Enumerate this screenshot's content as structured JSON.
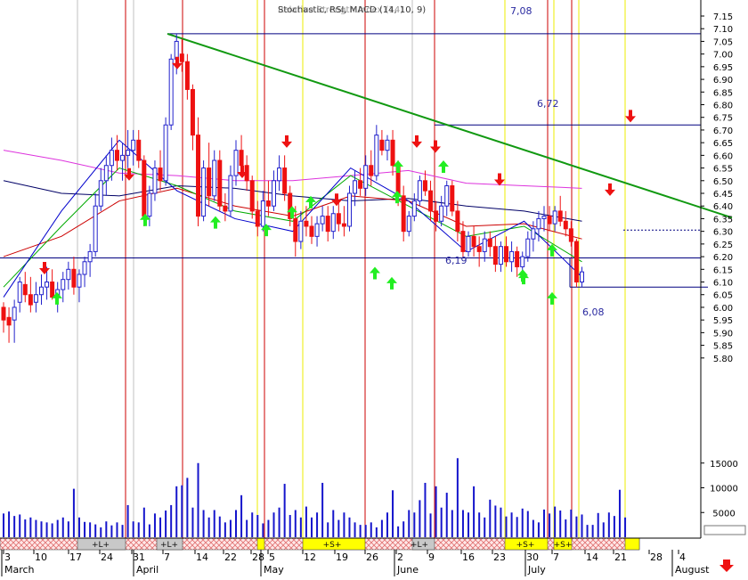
{
  "header": {
    "overlay_text": "Stochastic, RSI, MACD (14, 10, 9)",
    "overlay_text2": "Relative Strength Index (14)"
  },
  "colors": {
    "up_candle": "#2222cc",
    "down_candle": "#ee1111",
    "trendline": "#119911",
    "ma_magenta": "#dd33dd",
    "ma_navy": "#000066",
    "ma_red": "#cc0000",
    "ma_green": "#00aa00",
    "ma_blue": "#0000cc",
    "buy_arrow": "#22ee22",
    "sell_arrow": "#ee1111",
    "red_vline": "#cc0000",
    "yellow_vline": "#eeee00",
    "signal_yellow": "#ffff00",
    "signal_gray": "#c8c8c8",
    "signal_hatch": "#ffb4b4",
    "level_line": "#000080"
  },
  "chart_data": {
    "type": "candlestick",
    "price_axis": {
      "ylim": [
        5.78,
        7.18
      ],
      "tick_labels": [
        "7.15",
        "7.10",
        "7.05",
        "7.00",
        "6.95",
        "6.90",
        "6.85",
        "6.80",
        "6.75",
        "6.70",
        "6.65",
        "6.60",
        "6.55",
        "6.50",
        "6.45",
        "6.40",
        "6.35",
        "6.30",
        "6.25",
        "6.20",
        "6.15",
        "6.10",
        "6.05",
        "6.00",
        "5.95",
        "5.90",
        "5.85",
        "5.80"
      ]
    },
    "volume_axis": {
      "ylim": [
        0,
        17000
      ],
      "tick_labels": [
        "15000",
        "10000",
        "5000"
      ]
    },
    "level_annotations": [
      {
        "label": "7,08",
        "value": 7.08
      },
      {
        "label": "6,72",
        "value": 6.72
      },
      {
        "label": "6,19",
        "value": 6.195
      },
      {
        "label": "6,08",
        "value": 6.08
      }
    ],
    "dotted_level": 6.305,
    "trendline": {
      "from": {
        "x": "Apr 7",
        "y": 7.08
      },
      "to": {
        "x": "Aug 4",
        "y": 6.34
      }
    },
    "x_axis": {
      "day_labels": [
        "3",
        "10",
        "17",
        "24",
        "31",
        "7",
        "14",
        "22",
        "28",
        "5",
        "12",
        "19",
        "26",
        "2",
        "9",
        "16",
        "23",
        "30",
        "7",
        "14",
        "21",
        "28",
        "4"
      ],
      "month_labels": [
        "March",
        "April",
        "May",
        "June",
        "July",
        "August"
      ]
    },
    "signal_bar": {
      "labels": [
        "+L+",
        "+L+",
        "+S+",
        "+L+",
        "+S+",
        "+S+"
      ]
    },
    "candles": [
      {
        "o": 6.0,
        "h": 6.02,
        "l": 5.9,
        "c": 5.95
      },
      {
        "o": 5.96,
        "h": 6.0,
        "l": 5.86,
        "c": 5.93
      },
      {
        "o": 5.95,
        "h": 6.03,
        "l": 5.86,
        "c": 6.0
      },
      {
        "o": 6.02,
        "h": 6.12,
        "l": 5.98,
        "c": 6.1
      },
      {
        "o": 6.09,
        "h": 6.14,
        "l": 6.02,
        "c": 6.05
      },
      {
        "o": 6.05,
        "h": 6.12,
        "l": 5.98,
        "c": 6.01
      },
      {
        "o": 6.02,
        "h": 6.1,
        "l": 5.98,
        "c": 6.05
      },
      {
        "o": 6.05,
        "h": 6.13,
        "l": 6.01,
        "c": 6.08
      },
      {
        "o": 6.08,
        "h": 6.16,
        "l": 6.03,
        "c": 6.1
      },
      {
        "o": 6.1,
        "h": 6.15,
        "l": 6.03,
        "c": 6.04
      },
      {
        "o": 6.04,
        "h": 6.1,
        "l": 5.98,
        "c": 6.07
      },
      {
        "o": 6.07,
        "h": 6.14,
        "l": 6.02,
        "c": 6.11
      },
      {
        "o": 6.11,
        "h": 6.18,
        "l": 6.07,
        "c": 6.15
      },
      {
        "o": 6.15,
        "h": 6.2,
        "l": 6.05,
        "c": 6.08
      },
      {
        "o": 6.08,
        "h": 6.15,
        "l": 6.02,
        "c": 6.13
      },
      {
        "o": 6.13,
        "h": 6.2,
        "l": 6.08,
        "c": 6.18
      },
      {
        "o": 6.18,
        "h": 6.25,
        "l": 6.12,
        "c": 6.22
      },
      {
        "o": 6.22,
        "h": 6.45,
        "l": 6.2,
        "c": 6.4
      },
      {
        "o": 6.4,
        "h": 6.55,
        "l": 6.38,
        "c": 6.5
      },
      {
        "o": 6.5,
        "h": 6.6,
        "l": 6.44,
        "c": 6.56
      },
      {
        "o": 6.56,
        "h": 6.67,
        "l": 6.5,
        "c": 6.62
      },
      {
        "o": 6.62,
        "h": 6.68,
        "l": 6.54,
        "c": 6.58
      },
      {
        "o": 6.58,
        "h": 6.65,
        "l": 6.5,
        "c": 6.6
      },
      {
        "o": 6.6,
        "h": 6.7,
        "l": 6.55,
        "c": 6.62
      },
      {
        "o": 6.62,
        "h": 6.7,
        "l": 6.56,
        "c": 6.66
      },
      {
        "o": 6.66,
        "h": 6.7,
        "l": 6.55,
        "c": 6.58
      },
      {
        "o": 6.58,
        "h": 6.6,
        "l": 6.32,
        "c": 6.36
      },
      {
        "o": 6.36,
        "h": 6.48,
        "l": 6.32,
        "c": 6.45
      },
      {
        "o": 6.45,
        "h": 6.58,
        "l": 6.42,
        "c": 6.55
      },
      {
        "o": 6.55,
        "h": 6.62,
        "l": 6.46,
        "c": 6.5
      },
      {
        "o": 6.5,
        "h": 6.75,
        "l": 6.48,
        "c": 6.72
      },
      {
        "o": 6.72,
        "h": 7.0,
        "l": 6.7,
        "c": 6.98
      },
      {
        "o": 6.98,
        "h": 7.08,
        "l": 6.92,
        "c": 7.05
      },
      {
        "o": 7.0,
        "h": 7.06,
        "l": 6.93,
        "c": 6.97
      },
      {
        "o": 6.97,
        "h": 7.0,
        "l": 6.82,
        "c": 6.86
      },
      {
        "o": 6.86,
        "h": 6.88,
        "l": 6.62,
        "c": 6.68
      },
      {
        "o": 6.68,
        "h": 6.75,
        "l": 6.32,
        "c": 6.36
      },
      {
        "o": 6.36,
        "h": 6.58,
        "l": 6.34,
        "c": 6.55
      },
      {
        "o": 6.55,
        "h": 6.65,
        "l": 6.4,
        "c": 6.44
      },
      {
        "o": 6.44,
        "h": 6.62,
        "l": 6.42,
        "c": 6.58
      },
      {
        "o": 6.58,
        "h": 6.62,
        "l": 6.38,
        "c": 6.4
      },
      {
        "o": 6.4,
        "h": 6.45,
        "l": 6.34,
        "c": 6.38
      },
      {
        "o": 6.38,
        "h": 6.56,
        "l": 6.36,
        "c": 6.52
      },
      {
        "o": 6.52,
        "h": 6.66,
        "l": 6.48,
        "c": 6.62
      },
      {
        "o": 6.62,
        "h": 6.68,
        "l": 6.52,
        "c": 6.56
      },
      {
        "o": 6.56,
        "h": 6.6,
        "l": 6.46,
        "c": 6.5
      },
      {
        "o": 6.5,
        "h": 6.52,
        "l": 6.35,
        "c": 6.38
      },
      {
        "o": 6.38,
        "h": 6.42,
        "l": 6.28,
        "c": 6.32
      },
      {
        "o": 6.32,
        "h": 6.46,
        "l": 6.3,
        "c": 6.42
      },
      {
        "o": 6.42,
        "h": 6.5,
        "l": 6.36,
        "c": 6.4
      },
      {
        "o": 6.4,
        "h": 6.54,
        "l": 6.38,
        "c": 6.5
      },
      {
        "o": 6.5,
        "h": 6.6,
        "l": 6.46,
        "c": 6.55
      },
      {
        "o": 6.55,
        "h": 6.6,
        "l": 6.42,
        "c": 6.45
      },
      {
        "o": 6.45,
        "h": 6.48,
        "l": 6.32,
        "c": 6.35
      },
      {
        "o": 6.35,
        "h": 6.4,
        "l": 6.2,
        "c": 6.26
      },
      {
        "o": 6.26,
        "h": 6.38,
        "l": 6.23,
        "c": 6.34
      },
      {
        "o": 6.34,
        "h": 6.4,
        "l": 6.28,
        "c": 6.32
      },
      {
        "o": 6.32,
        "h": 6.36,
        "l": 6.25,
        "c": 6.28
      },
      {
        "o": 6.28,
        "h": 6.36,
        "l": 6.24,
        "c": 6.33
      },
      {
        "o": 6.33,
        "h": 6.4,
        "l": 6.3,
        "c": 6.36
      },
      {
        "o": 6.36,
        "h": 6.4,
        "l": 6.26,
        "c": 6.3
      },
      {
        "o": 6.3,
        "h": 6.4,
        "l": 6.27,
        "c": 6.37
      },
      {
        "o": 6.37,
        "h": 6.42,
        "l": 6.3,
        "c": 6.33
      },
      {
        "o": 6.33,
        "h": 6.4,
        "l": 6.28,
        "c": 6.32
      },
      {
        "o": 6.32,
        "h": 6.48,
        "l": 6.3,
        "c": 6.45
      },
      {
        "o": 6.45,
        "h": 6.54,
        "l": 6.4,
        "c": 6.5
      },
      {
        "o": 6.5,
        "h": 6.55,
        "l": 6.44,
        "c": 6.47
      },
      {
        "o": 6.47,
        "h": 6.6,
        "l": 6.44,
        "c": 6.56
      },
      {
        "o": 6.56,
        "h": 6.62,
        "l": 6.48,
        "c": 6.52
      },
      {
        "o": 6.52,
        "h": 6.72,
        "l": 6.5,
        "c": 6.68
      },
      {
        "o": 6.66,
        "h": 6.7,
        "l": 6.6,
        "c": 6.62
      },
      {
        "o": 6.62,
        "h": 6.68,
        "l": 6.58,
        "c": 6.66
      },
      {
        "o": 6.66,
        "h": 6.7,
        "l": 6.52,
        "c": 6.56
      },
      {
        "o": 6.56,
        "h": 6.58,
        "l": 6.4,
        "c": 6.44
      },
      {
        "o": 6.44,
        "h": 6.48,
        "l": 6.26,
        "c": 6.3
      },
      {
        "o": 6.3,
        "h": 6.38,
        "l": 6.28,
        "c": 6.36
      },
      {
        "o": 6.36,
        "h": 6.45,
        "l": 6.34,
        "c": 6.42
      },
      {
        "o": 6.42,
        "h": 6.52,
        "l": 6.4,
        "c": 6.5
      },
      {
        "o": 6.5,
        "h": 6.54,
        "l": 6.44,
        "c": 6.46
      },
      {
        "o": 6.46,
        "h": 6.5,
        "l": 6.34,
        "c": 6.38
      },
      {
        "o": 6.38,
        "h": 6.42,
        "l": 6.3,
        "c": 6.34
      },
      {
        "o": 6.34,
        "h": 6.44,
        "l": 6.32,
        "c": 6.4
      },
      {
        "o": 6.4,
        "h": 6.5,
        "l": 6.36,
        "c": 6.48
      },
      {
        "o": 6.48,
        "h": 6.5,
        "l": 6.36,
        "c": 6.38
      },
      {
        "o": 6.38,
        "h": 6.42,
        "l": 6.26,
        "c": 6.3
      },
      {
        "o": 6.3,
        "h": 6.34,
        "l": 6.2,
        "c": 6.22
      },
      {
        "o": 6.22,
        "h": 6.3,
        "l": 6.2,
        "c": 6.28
      },
      {
        "o": 6.28,
        "h": 6.32,
        "l": 6.2,
        "c": 6.24
      },
      {
        "o": 6.24,
        "h": 6.28,
        "l": 6.16,
        "c": 6.22
      },
      {
        "o": 6.22,
        "h": 6.3,
        "l": 6.18,
        "c": 6.27
      },
      {
        "o": 6.27,
        "h": 6.3,
        "l": 6.2,
        "c": 6.24
      },
      {
        "o": 6.24,
        "h": 6.28,
        "l": 6.14,
        "c": 6.17
      },
      {
        "o": 6.17,
        "h": 6.26,
        "l": 6.14,
        "c": 6.24
      },
      {
        "o": 6.24,
        "h": 6.28,
        "l": 6.16,
        "c": 6.18
      },
      {
        "o": 6.18,
        "h": 6.26,
        "l": 6.14,
        "c": 6.22
      },
      {
        "o": 6.22,
        "h": 6.24,
        "l": 6.12,
        "c": 6.16
      },
      {
        "o": 6.16,
        "h": 6.22,
        "l": 6.12,
        "c": 6.2
      },
      {
        "o": 6.2,
        "h": 6.3,
        "l": 6.18,
        "c": 6.27
      },
      {
        "o": 6.27,
        "h": 6.34,
        "l": 6.22,
        "c": 6.31
      },
      {
        "o": 6.31,
        "h": 6.38,
        "l": 6.26,
        "c": 6.35
      },
      {
        "o": 6.35,
        "h": 6.4,
        "l": 6.3,
        "c": 6.36
      },
      {
        "o": 6.36,
        "h": 6.4,
        "l": 6.3,
        "c": 6.33
      },
      {
        "o": 6.33,
        "h": 6.4,
        "l": 6.3,
        "c": 6.38
      },
      {
        "o": 6.38,
        "h": 6.44,
        "l": 6.32,
        "c": 6.34
      },
      {
        "o": 6.34,
        "h": 6.38,
        "l": 6.28,
        "c": 6.31
      },
      {
        "o": 6.31,
        "h": 6.34,
        "l": 6.24,
        "c": 6.26
      },
      {
        "o": 6.26,
        "h": 6.27,
        "l": 6.08,
        "c": 6.1
      },
      {
        "o": 6.1,
        "h": 6.16,
        "l": 6.08,
        "c": 6.14
      }
    ],
    "volume": [
      4800,
      5200,
      4300,
      4600,
      3600,
      4000,
      3500,
      3200,
      3000,
      2800,
      3500,
      4000,
      3200,
      9800,
      4000,
      3100,
      3000,
      2600,
      2000,
      3200,
      2400,
      3000,
      2500,
      6500,
      3200,
      3000,
      6000,
      2600,
      4800,
      4000,
      5400,
      6500,
      10300,
      10500,
      12000,
      6000,
      15000,
      5500,
      4000,
      5500,
      4200,
      3000,
      3500,
      5500,
      8500,
      3500,
      5000,
      4500,
      2800,
      3500,
      5000,
      6000,
      10800,
      4500,
      5500,
      4000,
      6200,
      4000,
      5000,
      11000,
      3000,
      5500,
      3500,
      5000,
      4000,
      3000,
      2500,
      2500,
      3000,
      2000,
      3500,
      5000,
      9500,
      2200,
      3200,
      5500,
      5000,
      7500,
      11000,
      4800,
      10300,
      6000,
      9000,
      5500,
      16000,
      5500,
      5000,
      10300,
      5000,
      4000,
      7600,
      6400,
      6000,
      4200,
      5000,
      4100,
      5800,
      5300,
      3500,
      3000,
      5600,
      4800,
      6200,
      5400,
      3600,
      5600,
      4200,
      4600,
      2500,
      2500,
      4900,
      3000,
      5000,
      4300,
      9600,
      4000
    ],
    "buy_arrows": [
      6.06,
      6.37,
      6.36,
      6.33,
      6.4,
      6.44,
      6.12,
      6.14,
      6.25,
      6.58,
      6.58,
      6.46,
      6.16,
      6.15,
      6.06
    ],
    "sell_arrows": [
      6.13,
      6.5,
      6.94,
      6.51,
      6.63,
      6.4,
      6.63,
      6.61,
      6.48,
      6.73,
      6.44
    ],
    "moving_averages": [
      {
        "name": "magenta",
        "values": [
          6.62,
          6.58,
          6.53,
          6.52,
          6.5,
          6.5,
          6.52,
          6.54,
          6.49,
          6.48,
          6.47
        ]
      },
      {
        "name": "navy",
        "values": [
          6.5,
          6.45,
          6.44,
          6.48,
          6.47,
          6.44,
          6.42,
          6.43,
          6.4,
          6.38,
          6.34
        ]
      },
      {
        "name": "red",
        "values": [
          6.2,
          6.28,
          6.42,
          6.47,
          6.4,
          6.36,
          6.44,
          6.42,
          6.32,
          6.33,
          6.27
        ]
      },
      {
        "name": "green",
        "values": [
          6.08,
          6.32,
          6.55,
          6.48,
          6.38,
          6.34,
          6.52,
          6.4,
          6.28,
          6.32,
          6.18
        ]
      },
      {
        "name": "blue",
        "values": [
          6.04,
          6.38,
          6.66,
          6.46,
          6.35,
          6.3,
          6.55,
          6.42,
          6.22,
          6.34,
          6.12
        ]
      }
    ]
  }
}
